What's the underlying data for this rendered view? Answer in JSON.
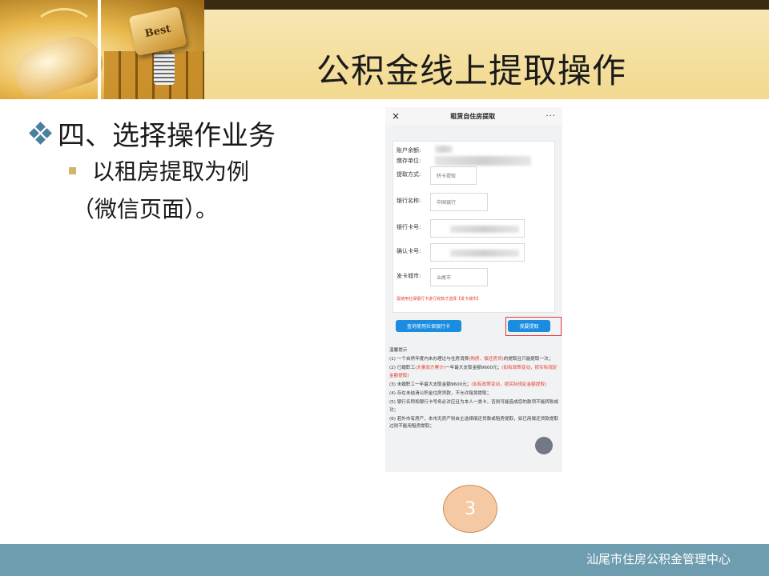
{
  "slide": {
    "title": "公积金线上提取操作",
    "bullet": "四、选择操作业务",
    "sub_bullet": "以租房提取为例",
    "sub_bullet_cont": "（微信页面）。",
    "page_number": "3",
    "footer": "汕尾市住房公积金管理中心",
    "header_image_text": "Best"
  },
  "phone": {
    "close_icon": "×",
    "title": "租赁自住房提取",
    "menu_icon": "···",
    "form": {
      "balance_label": "账户余额:",
      "unit_label": "缴存单位:",
      "method_label": "提取方式:",
      "method_value": "转卡提取",
      "bank_name_label": "银行名称:",
      "bank_name_value": "中国银行",
      "card_label": "银行卡号:",
      "confirm_card_label": "确认卡号:",
      "city_label": "发卡城市:",
      "city_value": "汕尾市",
      "note": "需使用社保银行卡进行收款才选择【发卡城市】"
    },
    "query_button": "查询使用社保银行卡",
    "apply_button": "我要提取",
    "tips": {
      "heading": "温馨提示",
      "items": [
        {
          "pre": "(1) 一个自然年度内未办理过与住房消费",
          "red": "(购房、偿还房贷)",
          "post": "的提取且只能提取一次；"
        },
        {
          "pre": "(2) 已婚职工",
          "red": "(夫妻双方累计)",
          "post": "一年最大支取金额9600元；",
          "red2": "(如有政策变动，按实际规定金额提取)"
        },
        {
          "pre": "(3) 未婚职工一年最大支取金额9600元；",
          "red": "(如有政策变动，按实际规定金额提取)",
          "post": ""
        },
        {
          "pre": "(4) 存在未结清公积金住房贷款，不允许租赁提取；",
          "red": "",
          "post": ""
        },
        {
          "pre": "(5) 银行名称和银行卡号务必对应且为本人一类卡，否则可能造成您的款项不能转账成功；",
          "red": "",
          "post": ""
        },
        {
          "pre": "(6) 若外市有房产，本市无房产则自主选择偿还贷款或租房提取，如已用偿还贷款提取过则不能用租房提取；",
          "red": "",
          "post": ""
        }
      ]
    },
    "float_icon": "‹"
  },
  "colors": {
    "title_bar": "#3a2a14",
    "header_band": "#f2d98f",
    "footer_bar": "#6d9dae",
    "bullet_diamond": "#4a7f9e",
    "sub_bullet_square": "#d4b46a",
    "phone_button": "#1a8de0",
    "warning_red": "#e43b2b"
  }
}
